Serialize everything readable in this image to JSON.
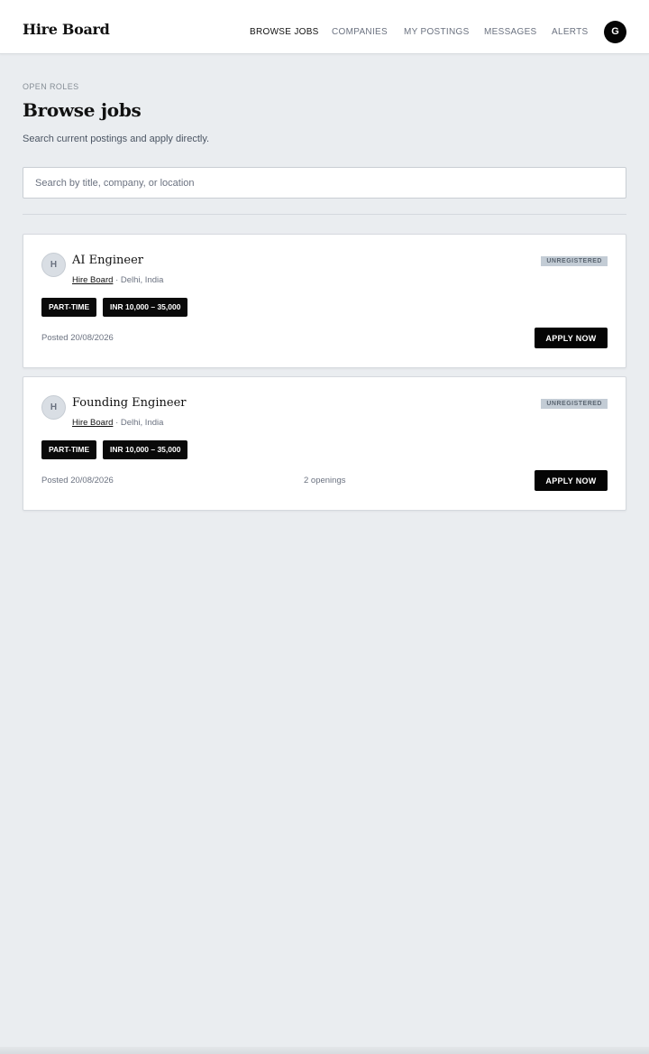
{
  "app": {
    "logo": "Hire Board",
    "nav": [
      "BROWSE JOBS",
      "COMPANIES",
      "MY POSTINGS",
      "MESSAGES",
      "ALERTS"
    ],
    "active_nav": "BROWSE JOBS",
    "user_initial": "G"
  },
  "page": {
    "eyebrow": "OPEN ROLES",
    "title": "Browse jobs",
    "subtitle": "Search current postings and apply directly."
  },
  "search": {
    "placeholder": "Search by title, company, or location",
    "value": ""
  },
  "jobs": [
    {
      "initial": "H",
      "title": "AI Engineer",
      "company": "Hire Board",
      "separator": "·",
      "location": "Delhi, India",
      "status": "UNREGISTERED",
      "type": "PART-TIME",
      "salary": "INR 10,000 – 35,000",
      "posted": "Posted 20/08/2026",
      "openings": "",
      "apply_label": "APPLY NOW"
    },
    {
      "initial": "H",
      "title": "Founding Engineer",
      "company": "Hire Board",
      "separator": "·",
      "location": "Delhi, India",
      "status": "UNREGISTERED",
      "type": "PART-TIME",
      "salary": "INR 10,000 – 35,000",
      "posted": "Posted 20/08/2026",
      "openings": "2 openings",
      "apply_label": "APPLY NOW"
    }
  ],
  "colors": {
    "page_bg": "#eaedf0",
    "primary": "#050505",
    "badge_bg": "#c3ccd5"
  }
}
